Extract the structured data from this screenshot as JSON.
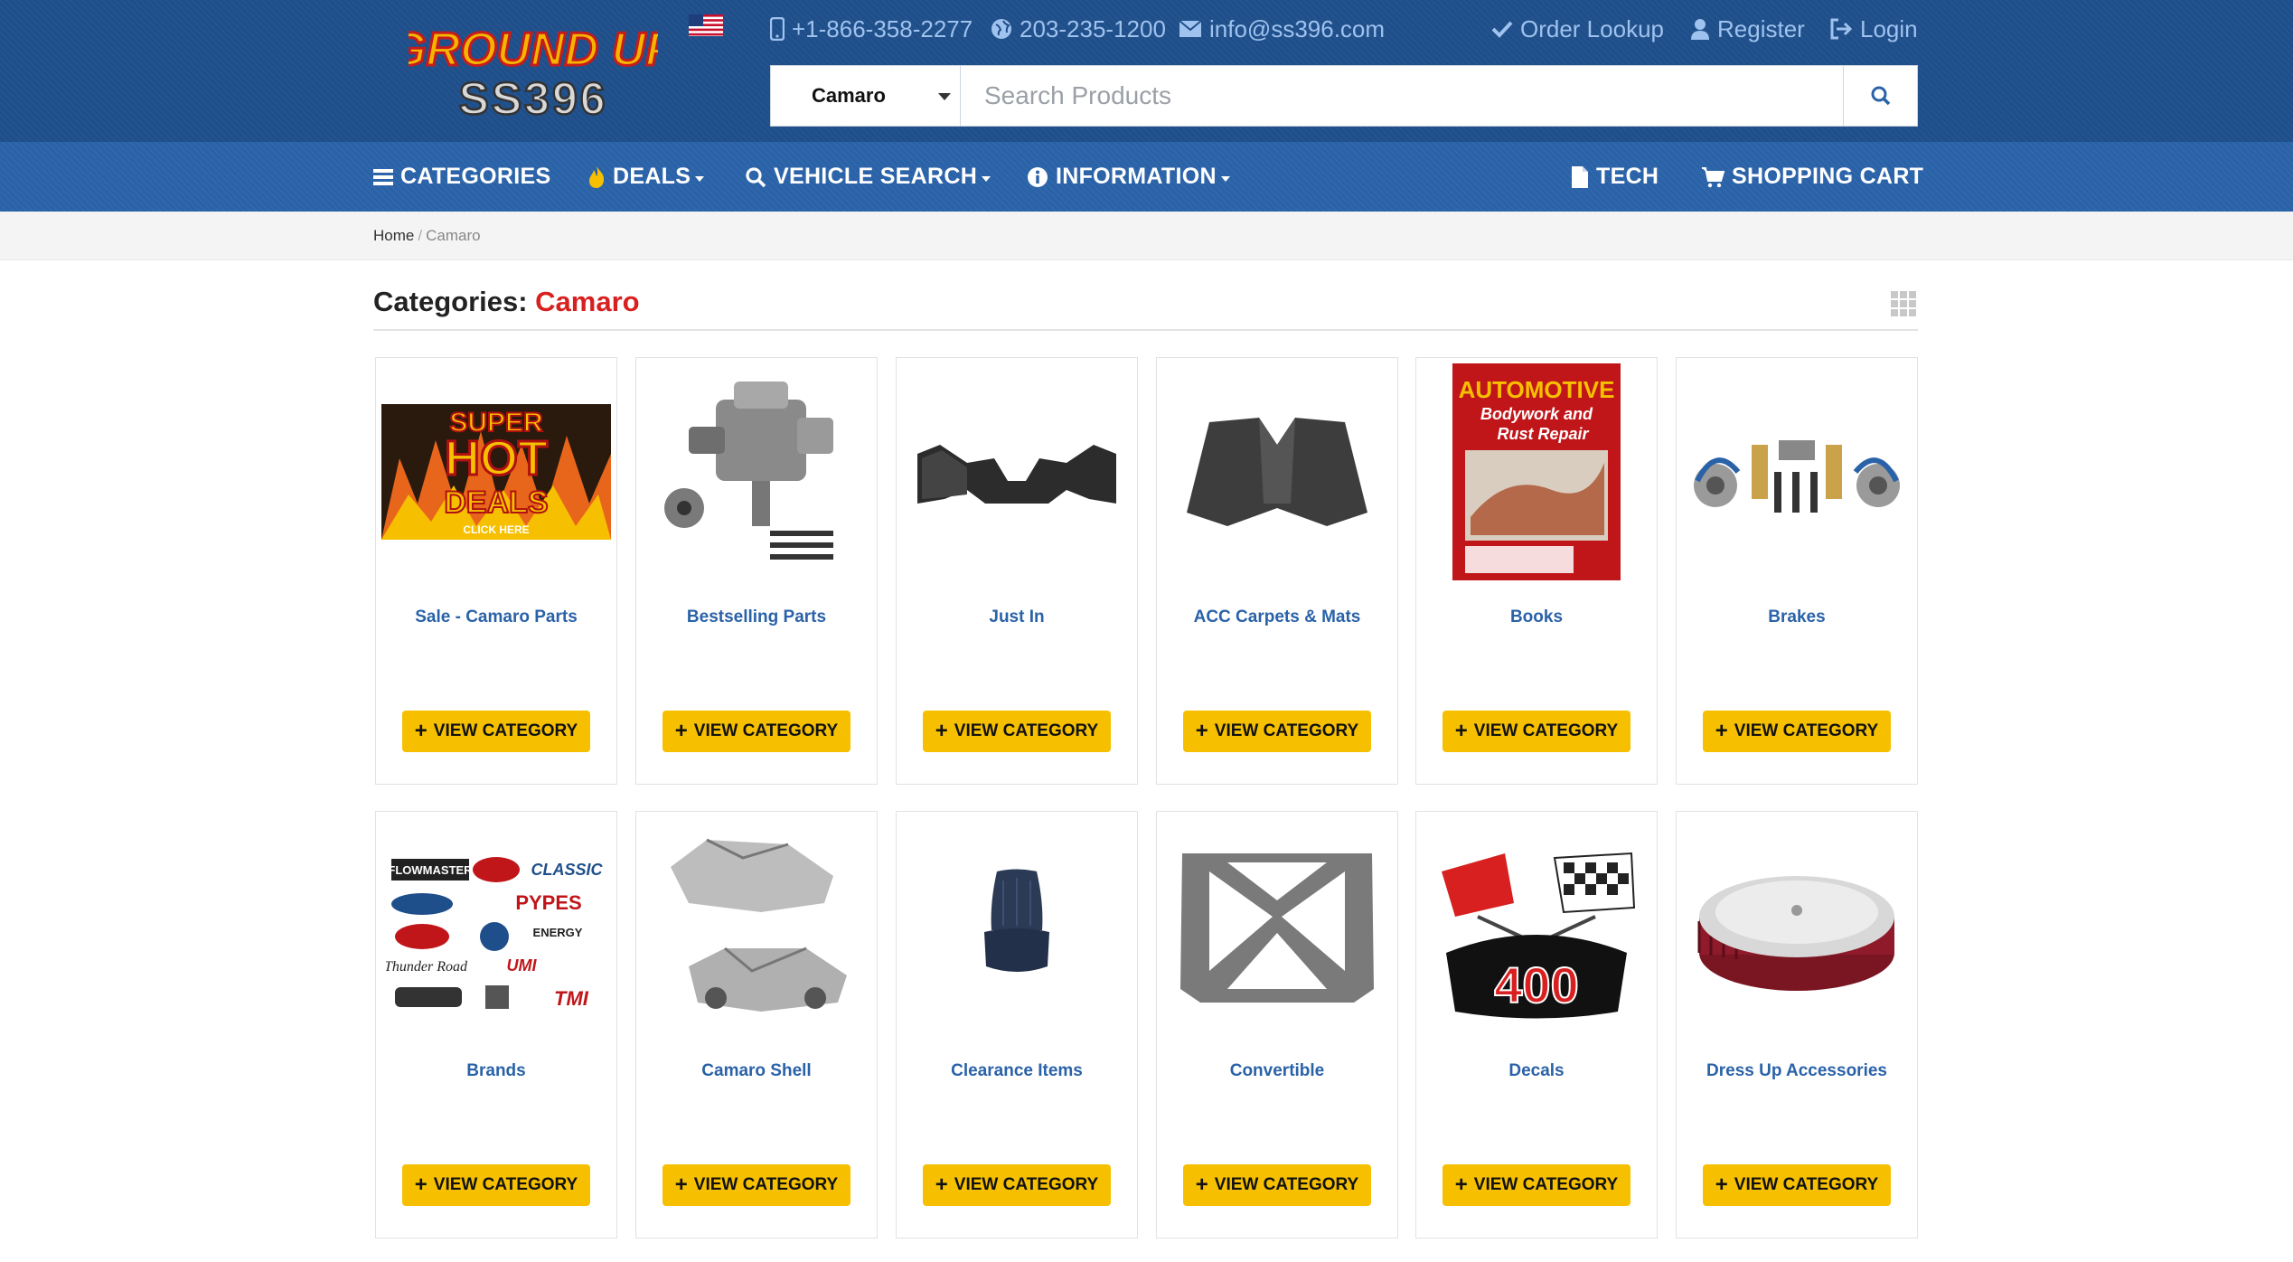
{
  "header": {
    "logo_line1": "GROUND UP",
    "logo_line2": "SS396",
    "phone_tollfree": "+1-866-358-2277",
    "phone_local": "203-235-1200",
    "email": "info@ss396.com",
    "order_lookup": "Order Lookup",
    "register": "Register",
    "login": "Login"
  },
  "search": {
    "select_value": "Camaro",
    "placeholder": "Search Products"
  },
  "nav": {
    "categories": "CATEGORIES",
    "deals": "DEALS",
    "vehicle_search": "VEHICLE SEARCH",
    "information": "INFORMATION",
    "tech": "TECH",
    "shopping_cart": "SHOPPING CART"
  },
  "breadcrumb": {
    "home": "Home",
    "separator": "/",
    "current": "Camaro"
  },
  "page": {
    "heading_label": "Categories:",
    "heading_value": "Camaro"
  },
  "categories": [
    {
      "name": "Sale - Camaro Parts",
      "button": "VIEW CATEGORY",
      "image_text": [
        "SUPER",
        "HOT",
        "DEALS",
        "CLICK HERE"
      ]
    },
    {
      "name": "Bestselling Parts",
      "button": "VIEW CATEGORY"
    },
    {
      "name": "Just In",
      "button": "VIEW CATEGORY"
    },
    {
      "name": "ACC Carpets & Mats",
      "button": "VIEW CATEGORY"
    },
    {
      "name": "Books",
      "button": "VIEW CATEGORY",
      "image_text": [
        "AUTOMOTIVE",
        "Bodywork and",
        "Rust Repair"
      ]
    },
    {
      "name": "Brakes",
      "button": "VIEW CATEGORY"
    },
    {
      "name": "Brands",
      "button": "VIEW CATEGORY",
      "image_text": [
        "FLOWMASTER",
        "CLASSIC",
        "PYPES",
        "ENERGY",
        "Thunder Road",
        "UMI",
        "TMI"
      ]
    },
    {
      "name": "Camaro Shell",
      "button": "VIEW CATEGORY"
    },
    {
      "name": "Clearance Items",
      "button": "VIEW CATEGORY"
    },
    {
      "name": "Convertible",
      "button": "VIEW CATEGORY"
    },
    {
      "name": "Decals",
      "button": "VIEW CATEGORY",
      "image_text": [
        "400"
      ]
    },
    {
      "name": "Dress Up Accessories",
      "button": "VIEW CATEGORY"
    }
  ],
  "colors": {
    "header_bg": "#1f4f8a",
    "nav_bg": "#2a62a8",
    "link_blue": "#2a62a8",
    "accent_red": "#d82020",
    "button_yellow": "#f6c000"
  },
  "icons": {
    "phone": "mobile-phone-icon",
    "globe": "globe-icon",
    "email": "envelope-icon",
    "order": "checkmark-icon",
    "register": "user-icon",
    "login": "sign-in-icon",
    "search": "search-icon",
    "categories": "hamburger-icon",
    "deals": "fire-icon",
    "vehicle_search": "search-icon",
    "information": "info-circle-icon",
    "tech": "document-icon",
    "cart": "shopping-cart-icon",
    "grid": "grid-view-icon",
    "flag": "us-flag-icon"
  }
}
